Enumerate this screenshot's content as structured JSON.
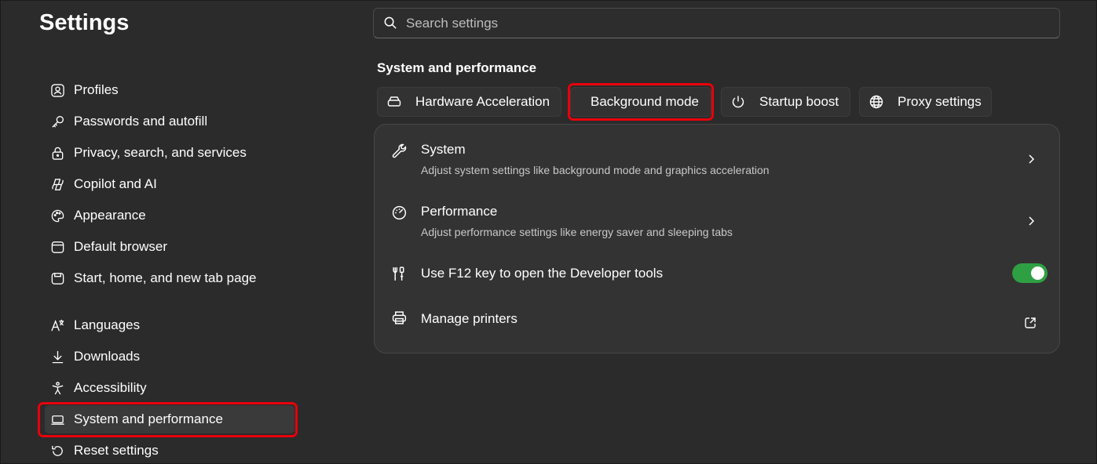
{
  "sidebar": {
    "title": "Settings",
    "items": [
      {
        "label": "Profiles",
        "icon": "profile-icon"
      },
      {
        "label": "Passwords and autofill",
        "icon": "key-icon"
      },
      {
        "label": "Privacy, search, and services",
        "icon": "lock-icon"
      },
      {
        "label": "Copilot and AI",
        "icon": "copilot-icon"
      },
      {
        "label": "Appearance",
        "icon": "palette-icon"
      },
      {
        "label": "Default browser",
        "icon": "browser-icon"
      },
      {
        "label": "Start, home, and new tab page",
        "icon": "home-tab-icon"
      },
      {
        "label": "Languages",
        "icon": "languages-icon"
      },
      {
        "label": "Downloads",
        "icon": "download-icon"
      },
      {
        "label": "Accessibility",
        "icon": "accessibility-icon"
      },
      {
        "label": "System and performance",
        "icon": "laptop-icon",
        "active": true
      },
      {
        "label": "Reset settings",
        "icon": "reset-icon"
      }
    ]
  },
  "search": {
    "placeholder": "Search settings",
    "value": ""
  },
  "main": {
    "section_title": "System and performance",
    "chips": [
      {
        "label": "Hardware Acceleration",
        "icon": "hardware-icon"
      },
      {
        "label": "Background mode",
        "icon": ""
      },
      {
        "label": "Startup boost",
        "icon": "power-icon"
      },
      {
        "label": "Proxy settings",
        "icon": "globe-icon"
      }
    ],
    "rows": [
      {
        "title": "System",
        "description": "Adjust system settings like background mode and graphics acceleration",
        "icon": "wrench-icon",
        "action": "chevron-right-icon"
      },
      {
        "title": "Performance",
        "description": "Adjust performance settings like energy saver and sleeping tabs",
        "icon": "speedometer-icon",
        "action": "chevron-right-icon"
      },
      {
        "title": "Use F12 key to open the Developer tools",
        "icon": "devtools-icon",
        "action": "toggle",
        "toggle_on": true
      },
      {
        "title": "Manage printers",
        "icon": "printer-icon",
        "action": "external-link-icon"
      }
    ]
  },
  "colors": {
    "background": "#2b2b2b",
    "card": "#333333",
    "toggle_on": "#2ea043",
    "highlight": "#e8000b"
  }
}
